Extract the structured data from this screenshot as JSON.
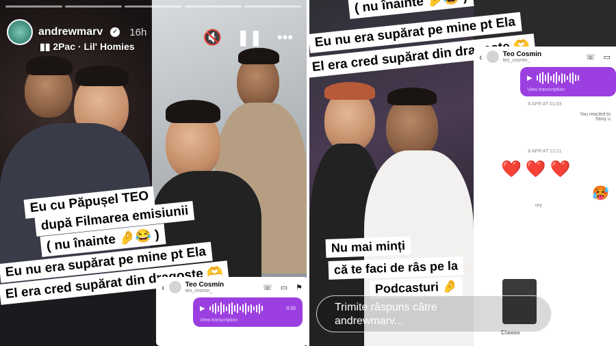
{
  "story": {
    "username": "andrewmarv",
    "time": "16h",
    "music": "2Pac · Lil' Homies",
    "controls": {
      "mute_icon": "speaker-muted-icon",
      "pause_icon": "pause-icon",
      "more_icon": "more-icon"
    }
  },
  "left_captions": [
    "Eu cu Păpușel TEO",
    "după Filmarea emisiunii",
    "( nu înainte 🤌😂 )",
    "Eu nu era supărat pe mine pt Ela",
    "El era cred supărat din dragoste 🫶"
  ],
  "right_captions_top": [
    "( nu înainte 🤌😂 )",
    "Eu nu era supărat pe mine pt Ela",
    "El era cred supărat din dragoste 🫶"
  ],
  "right_caption_bottom": [
    "Nu mai minți",
    "că te faci de râs pe la",
    "Podcasturi 🤌"
  ],
  "chat": {
    "name": "Teo Cosmin",
    "handle": "teo_cosmin_",
    "voice_time": "0:20",
    "view_transcription": "View transcription",
    "date1": "8 APR AT 01:03",
    "reacted": "You reacted to",
    "story_label": "Story u",
    "date2": "8 APR AT 12:21",
    "hearts": [
      "❤️",
      "❤️",
      "❤️"
    ],
    "reply_snip": "ury",
    "eheeee": "Eheeee"
  },
  "reply": {
    "placeholder_line1": "Trimite răspuns către",
    "placeholder_line2": "andrewmarv..."
  },
  "accent": "#9b3fe0"
}
